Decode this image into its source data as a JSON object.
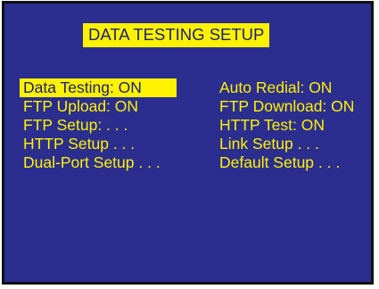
{
  "title": "DATA TESTING SETUP",
  "menu": {
    "left": [
      {
        "label": "Data Testing: ON",
        "selected": true
      },
      {
        "label": "FTP Upload: ON"
      },
      {
        "label": "FTP Setup: . . ."
      },
      {
        "label": "HTTP Setup . . ."
      },
      {
        "label": "Dual-Port Setup . . ."
      }
    ],
    "right": [
      {
        "label": "Auto Redial: ON"
      },
      {
        "label": "FTP Download: ON"
      },
      {
        "label": "HTTP Test: ON"
      },
      {
        "label": "Link Setup . . ."
      },
      {
        "label": "Default Setup . . ."
      }
    ]
  },
  "colors": {
    "background": "#2b2e8e",
    "text": "#fef200",
    "highlight": "#fef200",
    "highlight_text": "#1d1f7a"
  }
}
